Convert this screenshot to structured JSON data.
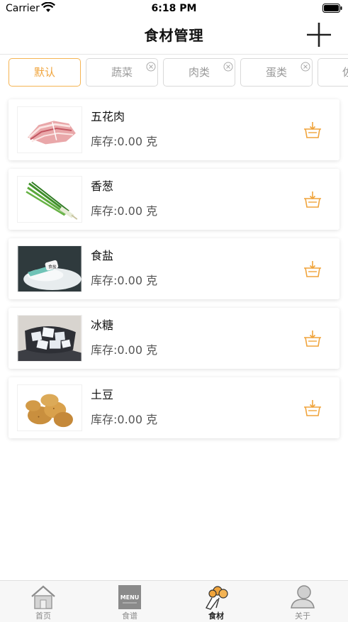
{
  "status": {
    "carrier": "Carrier",
    "time": "6:18 PM"
  },
  "nav": {
    "title": "食材管理",
    "add_icon": "plus-icon"
  },
  "colors": {
    "accent": "#f0a43c",
    "tab_border": "#d9d9d9",
    "text_gray": "#999999"
  },
  "categories": [
    {
      "label": "默认",
      "active": true,
      "removable": false
    },
    {
      "label": "蔬菜",
      "active": false,
      "removable": true
    },
    {
      "label": "肉类",
      "active": false,
      "removable": true
    },
    {
      "label": "蛋类",
      "active": false,
      "removable": true
    },
    {
      "label": "佐",
      "active": false,
      "removable": false
    }
  ],
  "ingredients": [
    {
      "name": "五花肉",
      "stock": "库存:0.00 克",
      "icon": "pork-belly-image"
    },
    {
      "name": "香葱",
      "stock": "库存:0.00 克",
      "icon": "scallion-image"
    },
    {
      "name": "食盐",
      "stock": "库存:0.00 克",
      "icon": "salt-image"
    },
    {
      "name": "冰糖",
      "stock": "库存:0.00 克",
      "icon": "rock-sugar-image"
    },
    {
      "name": "土豆",
      "stock": "库存:0.00 克",
      "icon": "potato-image"
    }
  ],
  "tabbar": [
    {
      "label": "首页",
      "icon": "home-icon",
      "active": false
    },
    {
      "label": "食谱",
      "icon": "menu-icon",
      "active": false
    },
    {
      "label": "食材",
      "icon": "ingredients-icon",
      "active": true
    },
    {
      "label": "关于",
      "icon": "about-icon",
      "active": false
    }
  ]
}
